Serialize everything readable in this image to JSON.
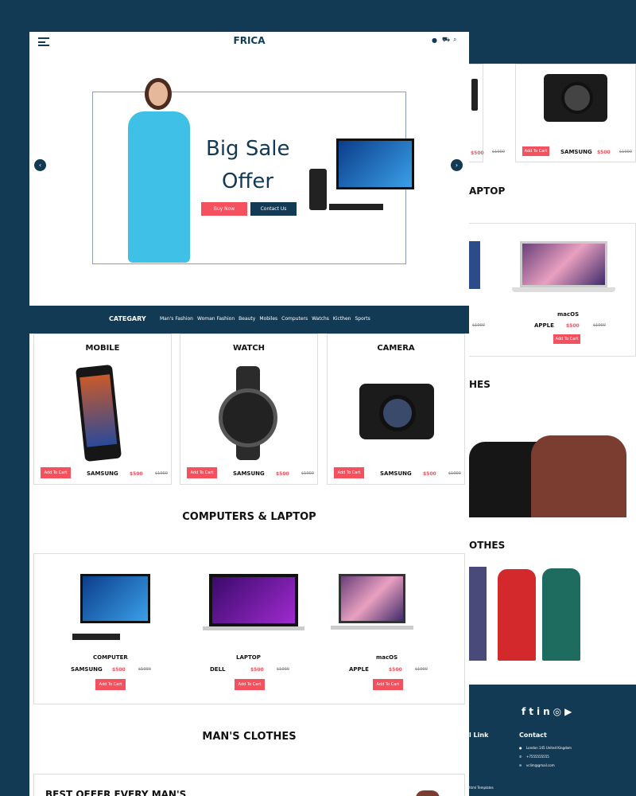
{
  "header": {
    "logo": "FRICA"
  },
  "hero": {
    "title_line1": "Big Sale",
    "title_line2": "Offer",
    "buy_now": "Buy Now",
    "contact_us": "Contact Us"
  },
  "category_bar": {
    "title": "CATEGARY",
    "items": [
      "Man's Fashion",
      "Woman Fashion",
      "Beauty",
      "Mobiles",
      "Computers",
      "Watchs",
      "Kicthen",
      "Sports"
    ]
  },
  "featured": [
    {
      "title": "MOBILE",
      "brand": "SAMSUNG",
      "price": "$500",
      "old_price": "$1000",
      "cta": "Add To Cart"
    },
    {
      "title": "WATCH",
      "brand": "SAMSUNG",
      "price": "$500",
      "old_price": "$1000",
      "cta": "Add To Cart"
    },
    {
      "title": "CAMERA",
      "brand": "SAMSUNG",
      "price": "$500",
      "old_price": "$1000",
      "cta": "Add To Cart"
    }
  ],
  "computers": {
    "heading": "COMPUTERS & LAPTOP",
    "items": [
      {
        "name": "COMPUTER",
        "brand": "SAMSUNG",
        "price": "$500",
        "old_price": "$1000",
        "cta": "Add To Cart"
      },
      {
        "name": "LAPTOP",
        "brand": "DELL",
        "price": "$500",
        "old_price": "$1000",
        "cta": "Add To Cart"
      },
      {
        "name": "macOS",
        "brand": "APPLE",
        "price": "$500",
        "old_price": "$1000",
        "cta": "Add To Cart"
      }
    ]
  },
  "mens": {
    "heading": "MAN'S CLOTHES",
    "offer_title": "BEST OFFER EVERY MAN'S"
  },
  "back": {
    "camera": {
      "brand": "SAMSUNG",
      "price": "$500",
      "old_price": "$1000",
      "cta": "Add To Cart",
      "left_price": "$500",
      "left_old": "$1000"
    },
    "laptop_heading": "APTOP",
    "laptop": {
      "name": "macOS",
      "brand": "APPLE",
      "price": "$500",
      "old_price": "$1000",
      "cta": "Add To Cart",
      "left_old": "$1000"
    },
    "clothes_heading": "HES",
    "clothes2_heading": "OTHES"
  },
  "footer": {
    "link_heading": "l Link",
    "contact_heading": "Contact",
    "address": "London 145 United Kingdom",
    "phone": "+7555555555",
    "email": "vclim@gmail.com",
    "copyright": "html Templates"
  },
  "colors": {
    "navy": "#133a55",
    "accent": "#f4505e"
  }
}
